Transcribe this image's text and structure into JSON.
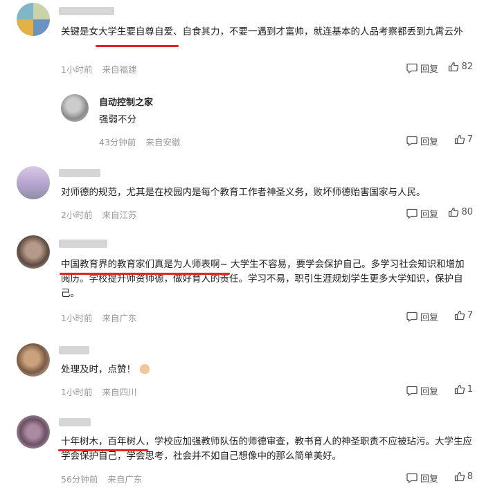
{
  "labels": {
    "reply": "回复"
  },
  "comments": [
    {
      "text": "关键是女大学生要自尊自爱、自食其力，不要一遇到才富帅，就连基本的人品考察都丢到九霄云外",
      "time": "1小时前",
      "location": "来自福建",
      "likes": "82",
      "reply": {
        "author": "自动控制之家",
        "text": "强弱不分",
        "time": "43分钟前",
        "location": "来自安徽",
        "likes": "7"
      }
    },
    {
      "text": "对师德的规范，尤其是在校园内是每个教育工作者神圣义务，败坏师德贻害国家与人民。",
      "time": "2小时前",
      "location": "来自江苏",
      "likes": "80"
    },
    {
      "text": "中国教育界的教育家们真是为人师表啊~ 大学生不容易，要学会保护自己。多学习社会知识和增加阅历。学校提升师资师德，做好育人的责任。学习不易，职引生涯规划学生更多大学知识，保护自己。",
      "time": "1小时前",
      "location": "来自广东",
      "likes": "7"
    },
    {
      "text": "处理及时，点赞！",
      "time": "1小时前",
      "location": "来自四川",
      "likes": "1"
    },
    {
      "text": "十年树木，百年树人，学校应加强教师队伍的师德审查，教书育人的神圣职责不应被玷污。大学生应学会保护自己，学会思考，社会并不如自己想像中的那么简单美好。",
      "time": "56分钟前",
      "location": "来自广东",
      "likes": "8"
    }
  ],
  "colors": {
    "underline": "#e8202a",
    "meta": "#999999"
  }
}
